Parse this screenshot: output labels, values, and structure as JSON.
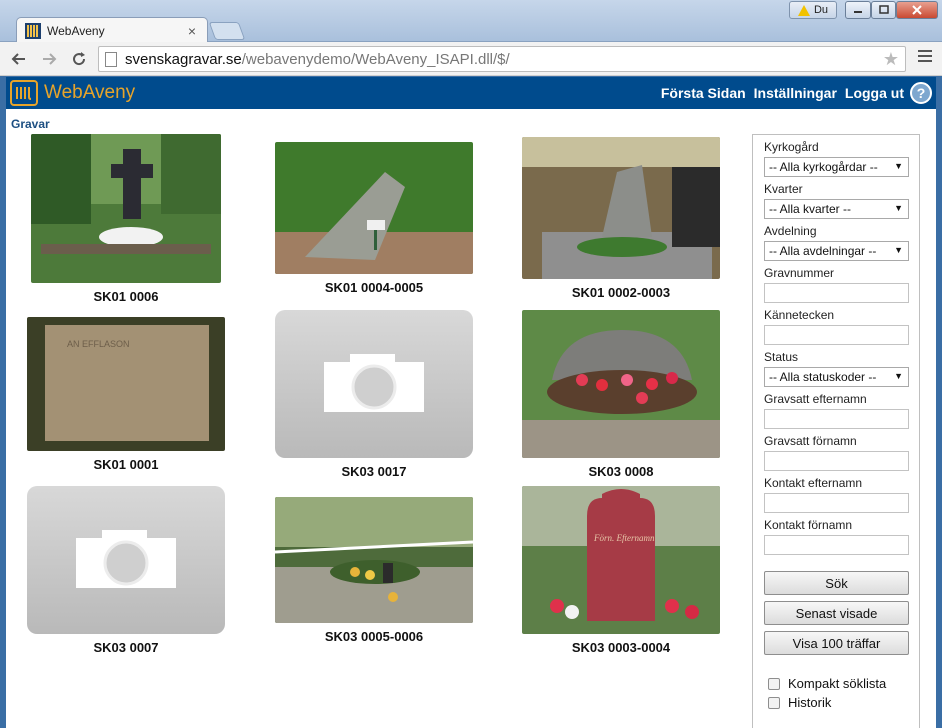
{
  "browser": {
    "tab_title": "WebAveny",
    "tab_close": "×",
    "user_badge": "Du",
    "url_host": "svenskagravar.se",
    "url_path": "/webavenydemo/WebAveny_ISAPI.dll/$/"
  },
  "header": {
    "logo_text": "WebAveny",
    "links": [
      "Första Sidan",
      "Inställningar",
      "Logga ut"
    ],
    "help_glyph": "?"
  },
  "content": {
    "section_title": "Gravar",
    "graves": [
      {
        "label": "SK01 0006",
        "image": "photo"
      },
      {
        "label": "SK01 0004-0005",
        "image": "photo"
      },
      {
        "label": "SK01 0002-0003",
        "image": "photo"
      },
      {
        "label": "SK01 0001",
        "image": "photo"
      },
      {
        "label": "SK03 0017",
        "image": "camera-placeholder"
      },
      {
        "label": "SK03 0008",
        "image": "photo"
      },
      {
        "label": "SK03 0007",
        "image": "camera-placeholder"
      },
      {
        "label": "SK03 0005-0006",
        "image": "photo"
      },
      {
        "label": "SK03 0003-0004",
        "image": "photo"
      }
    ]
  },
  "search": {
    "kyrkogard_label": "Kyrkogård",
    "kyrkogard_value": "-- Alla kyrkogårdar --",
    "kvarter_label": "Kvarter",
    "kvarter_value": "-- Alla kvarter --",
    "avdelning_label": "Avdelning",
    "avdelning_value": "-- Alla avdelningar --",
    "gravnummer_label": "Gravnummer",
    "kannetecken_label": "Kännetecken",
    "status_label": "Status",
    "status_value": "-- Alla statuskoder --",
    "gravsatt_efternamn_label": "Gravsatt efternamn",
    "gravsatt_fornamn_label": "Gravsatt förnamn",
    "kontakt_efternamn_label": "Kontakt efternamn",
    "kontakt_fornamn_label": "Kontakt förnamn",
    "sok_button": "Sök",
    "senast_button": "Senast visade",
    "visa_button": "Visa 100 träffar",
    "kompakt_label": "Kompakt söklista",
    "historik_label": "Historik"
  }
}
